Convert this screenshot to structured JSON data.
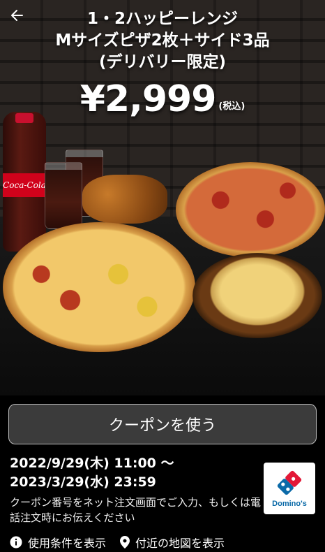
{
  "header": {
    "title_line1": "1・2ハッピーレンジ",
    "title_line2": "Mサイズピザ2枚＋サイド3品",
    "title_line3": "(デリバリー限定)",
    "price": "¥2,999",
    "tax_note": "(税込)"
  },
  "images": {
    "cola_label": "Coca-Cola"
  },
  "action": {
    "use_coupon_label": "クーポンを使う"
  },
  "validity": {
    "start": "2022/9/29(木) 11:00 〜",
    "end": "2023/3/29(水) 23:59"
  },
  "note": "クーポン番号をネット注文画面でご入力、もしくは電話注文時にお伝えください",
  "brand": {
    "logo_text": "Domino's",
    "colors": {
      "blue": "#0b6aa8",
      "red": "#e31837"
    }
  },
  "links": {
    "terms_label": "使用条件を表示",
    "map_label": "付近の地図を表示"
  },
  "icons": [
    "back-arrow-icon",
    "info-icon",
    "map-pin-icon",
    "dominos-logo-icon"
  ]
}
